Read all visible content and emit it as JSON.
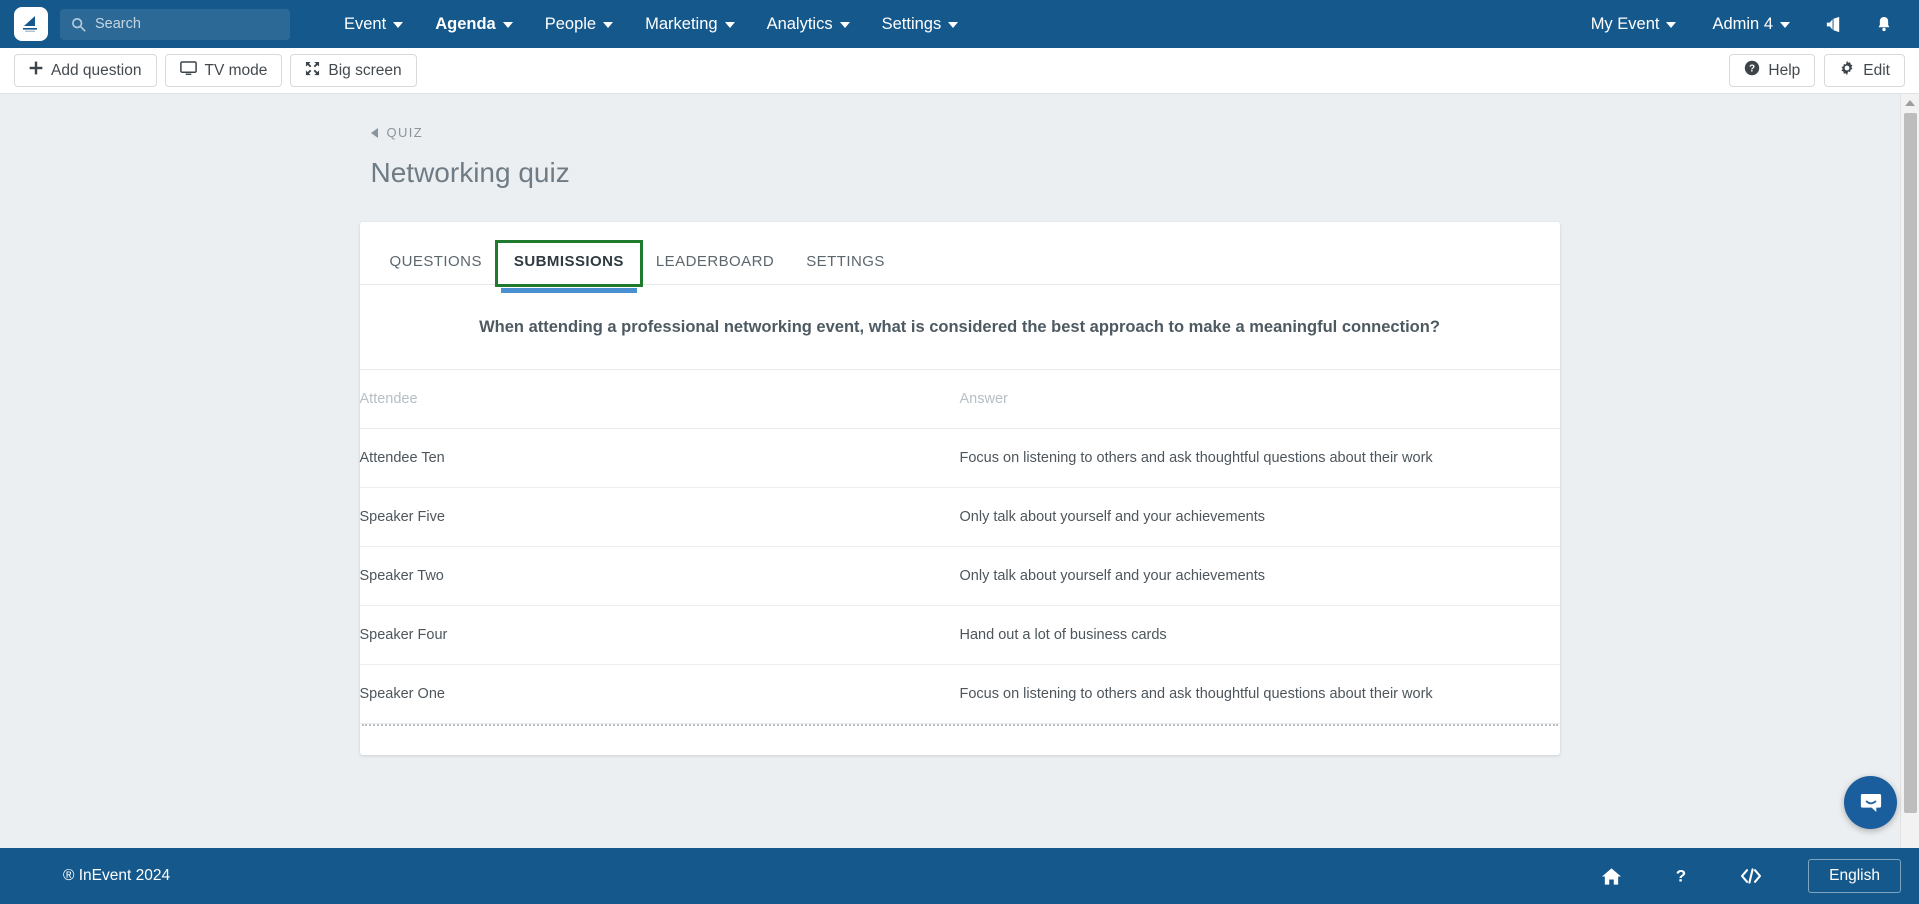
{
  "navbar": {
    "logo_name": "inevent-logo",
    "search": {
      "placeholder": "Search",
      "value": ""
    },
    "menu": [
      {
        "label": "Event",
        "active": false
      },
      {
        "label": "Agenda",
        "active": true
      },
      {
        "label": "People",
        "active": false
      },
      {
        "label": "Marketing",
        "active": false
      },
      {
        "label": "Analytics",
        "active": false
      },
      {
        "label": "Settings",
        "active": false
      }
    ],
    "event_selector": "My Event",
    "account": "Admin 4",
    "announcements_icon": "megaphone-icon",
    "notifications_icon": "bell-icon"
  },
  "toolbar": {
    "add_question": "Add question",
    "tv_mode": "TV mode",
    "big_screen": "Big screen",
    "help": "Help",
    "edit": "Edit"
  },
  "breadcrumb": {
    "label": "QUIZ"
  },
  "page": {
    "title": "Networking quiz"
  },
  "tabs": [
    {
      "label": "QUESTIONS",
      "active": false,
      "highlighted": false
    },
    {
      "label": "SUBMISSIONS",
      "active": true,
      "highlighted": true
    },
    {
      "label": "LEADERBOARD",
      "active": false,
      "highlighted": false
    },
    {
      "label": "SETTINGS",
      "active": false,
      "highlighted": false
    }
  ],
  "submissions": {
    "question": "When attending a professional networking event, what is considered the best approach to make a meaningful connection?",
    "columns": {
      "attendee": "Attendee",
      "answer": "Answer"
    },
    "rows": [
      {
        "attendee": "Attendee Ten",
        "answer": "Focus on listening to others and ask thoughtful questions about their work",
        "correct": true
      },
      {
        "attendee": "Speaker Five",
        "answer": "Only talk about yourself and your achievements",
        "correct": false
      },
      {
        "attendee": "Speaker Two",
        "answer": "Only talk about yourself and your achievements",
        "correct": false
      },
      {
        "attendee": "Speaker Four",
        "answer": "Hand out a lot of business cards",
        "correct": false
      },
      {
        "attendee": "Speaker One",
        "answer": "Focus on listening to others and ask thoughtful questions about their work",
        "correct": true
      }
    ]
  },
  "footer": {
    "copyright": "® InEvent 2024",
    "home_icon": "home-icon",
    "help_icon": "question-mark-icon",
    "code_icon": "code-icon",
    "language": "English"
  },
  "chat": {
    "icon": "chat-bubble-icon"
  },
  "colors": {
    "navbar_blue": "#15598c",
    "accent_blue": "#4a90d0",
    "answer_correct": "#84bd77",
    "answer_wrong": "#d9736e",
    "highlight_green": "#1f7a2e",
    "page_background": "#eceff1"
  }
}
